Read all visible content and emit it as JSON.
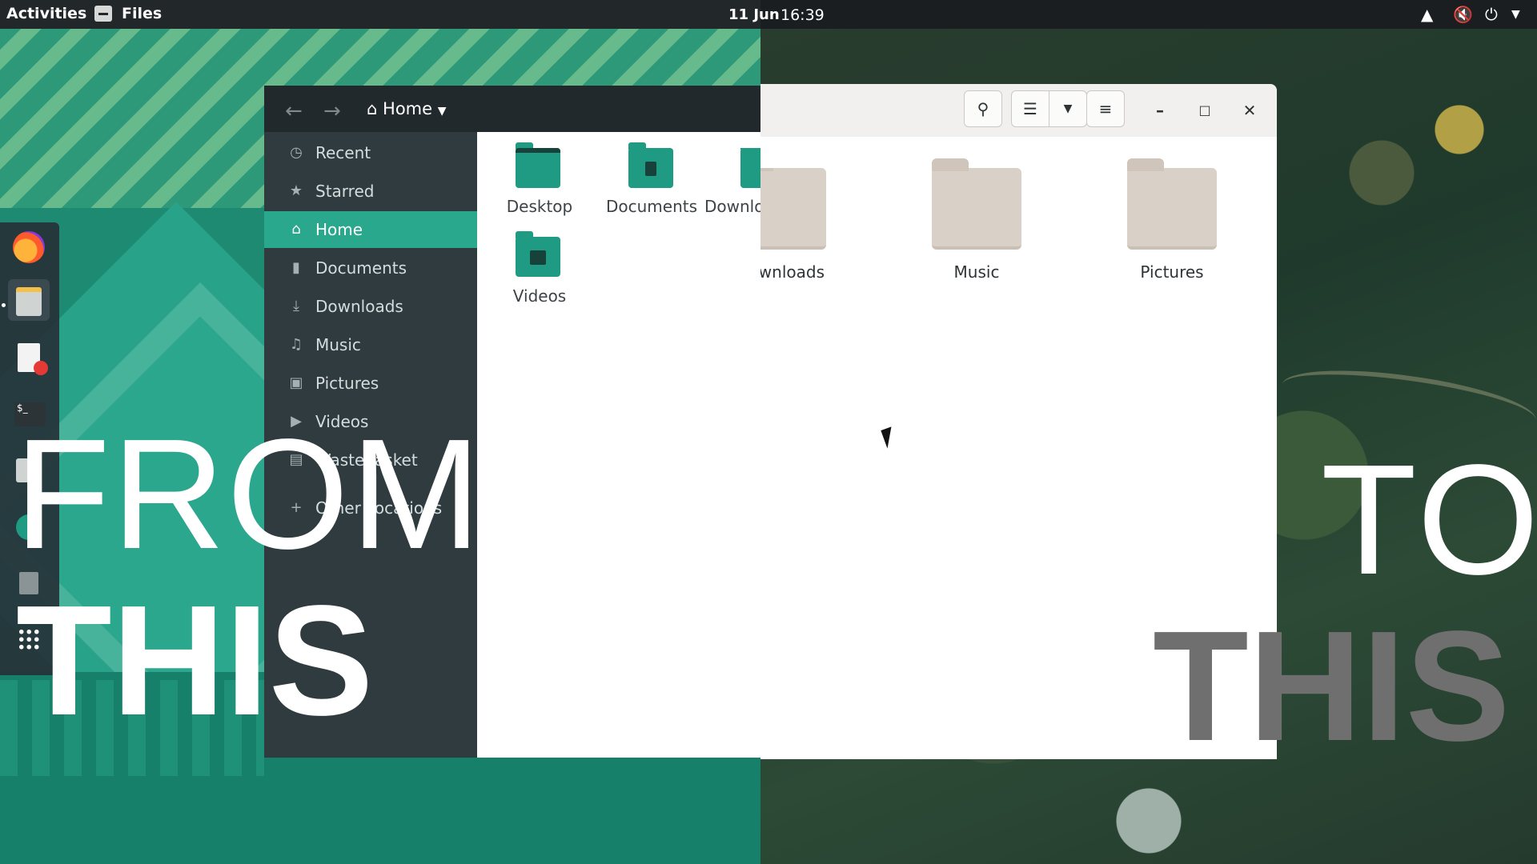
{
  "topbar": {
    "activities": "Activities",
    "app_name": "Files",
    "date": "11 Jun",
    "time": "16:39",
    "tray_icons": [
      "network-icon",
      "volume-muted-icon",
      "power-icon",
      "chevron-down-icon"
    ]
  },
  "dock": {
    "items": [
      "firefox-icon",
      "files-icon",
      "text-editor-icon",
      "terminal-icon",
      "installer-icon",
      "update-icon",
      "trash-icon",
      "app-grid-icon"
    ]
  },
  "old_window": {
    "path": "Home",
    "sidebar": [
      {
        "label": "Recent",
        "icon": "clock-icon",
        "active": false
      },
      {
        "label": "Starred",
        "icon": "star-icon",
        "active": false
      },
      {
        "label": "Home",
        "icon": "home-icon",
        "active": true
      },
      {
        "label": "Documents",
        "icon": "document-icon",
        "active": false
      },
      {
        "label": "Downloads",
        "icon": "download-icon",
        "active": false
      },
      {
        "label": "Music",
        "icon": "music-icon",
        "active": false
      },
      {
        "label": "Pictures",
        "icon": "picture-icon",
        "active": false
      },
      {
        "label": "Videos",
        "icon": "video-icon",
        "active": false
      },
      {
        "label": "Wastebasket",
        "icon": "trash-icon",
        "active": false
      },
      {
        "label": "Other Locations",
        "icon": "plus-icon",
        "active": false
      }
    ],
    "folders": [
      "Desktop",
      "Documents",
      "Downloads",
      "Videos"
    ]
  },
  "new_window": {
    "folders": [
      "Downloads",
      "Music",
      "Pictures"
    ]
  },
  "overlay": {
    "from": "FROM",
    "this_left": "THIS",
    "to": "TO",
    "this_right": "THIS"
  },
  "colors": {
    "old_accent": "#2aa88e",
    "old_sidebar": "#2f3b3f",
    "new_folder": "#d9d0c7",
    "topbar": "#1b1e21"
  }
}
